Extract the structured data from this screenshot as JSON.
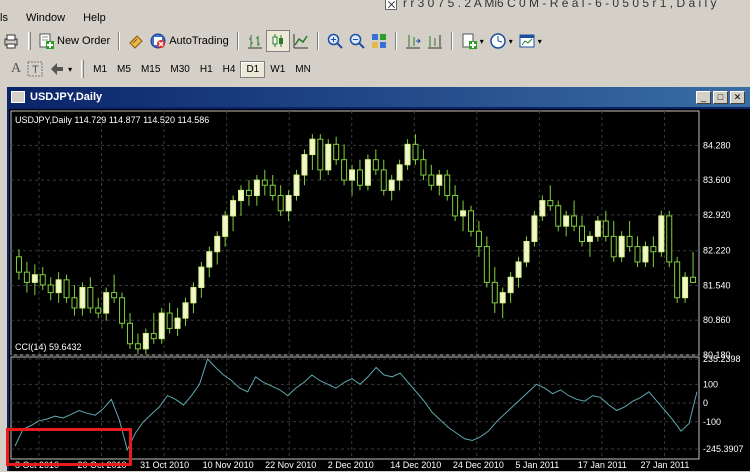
{
  "window_title_fragment": "r r 3 0 7 5 . 2 A Mi6 C 0 M - R e a l - 6 - 0 5 0 5 r 1 , D a i l y",
  "menu": [
    {
      "label": "ls"
    },
    {
      "label": "Window"
    },
    {
      "label": "Help"
    }
  ],
  "toolbar": {
    "new_order_label": "New Order",
    "auto_trading_label": "AutoTrading"
  },
  "timeframes": [
    "M1",
    "M5",
    "M15",
    "M30",
    "H1",
    "H4",
    "D1",
    "W1",
    "MN"
  ],
  "active_timeframe": "D1",
  "chart_window": {
    "title": "USDJPY,Daily",
    "header_text": "USDJPY,Daily  114.729 114.877 114.520 114.586",
    "indicator_text": "CCI(14) 59.6432"
  },
  "chart_data": {
    "type": "candlestick",
    "price_axis_ticks": [
      "84.280",
      "83.600",
      "82.920",
      "82.220",
      "81.540",
      "80.860",
      "80.180"
    ],
    "cci_axis_ticks": [
      "235.2398",
      "100",
      "0",
      "-100",
      "-245.3907"
    ],
    "x_tick_labels": [
      "8 Oct 2010",
      "20 Oct 2010",
      "31 Oct 2010",
      "10 Nov 2010",
      "22 Nov 2010",
      "2 Dec 2010",
      "14 Dec 2010",
      "24 Dec 2010",
      "5 Jan 2011",
      "17 Jan 2011",
      "27 Jan 2011"
    ],
    "price_range": [
      80.18,
      84.6
    ],
    "cci_range": [
      -245.3907,
      235.2398
    ],
    "candles": [
      [
        82.1,
        82.25,
        81.65,
        81.8
      ],
      [
        81.8,
        82.0,
        81.4,
        81.6
      ],
      [
        81.6,
        81.95,
        81.35,
        81.75
      ],
      [
        81.75,
        81.9,
        81.45,
        81.55
      ],
      [
        81.55,
        81.7,
        81.25,
        81.4
      ],
      [
        81.4,
        81.8,
        81.2,
        81.65
      ],
      [
        81.65,
        81.75,
        81.2,
        81.3
      ],
      [
        81.3,
        81.55,
        80.95,
        81.1
      ],
      [
        81.1,
        81.6,
        80.95,
        81.5
      ],
      [
        81.5,
        81.7,
        81.0,
        81.1
      ],
      [
        81.1,
        81.3,
        80.9,
        81.0
      ],
      [
        81.0,
        81.5,
        80.85,
        81.4
      ],
      [
        81.4,
        81.75,
        81.2,
        81.3
      ],
      [
        81.3,
        81.4,
        80.7,
        80.8
      ],
      [
        80.8,
        81.0,
        80.3,
        80.4
      ],
      [
        80.4,
        80.6,
        80.2,
        80.3
      ],
      [
        80.3,
        80.7,
        80.2,
        80.6
      ],
      [
        80.6,
        81.0,
        80.4,
        80.5
      ],
      [
        80.5,
        81.1,
        80.4,
        81.0
      ],
      [
        81.0,
        81.2,
        80.6,
        80.7
      ],
      [
        80.7,
        81.1,
        80.55,
        80.9
      ],
      [
        80.9,
        81.3,
        80.75,
        81.2
      ],
      [
        81.2,
        81.6,
        81.0,
        81.5
      ],
      [
        81.5,
        82.0,
        81.3,
        81.9
      ],
      [
        81.9,
        82.3,
        81.7,
        82.2
      ],
      [
        82.2,
        82.6,
        81.95,
        82.5
      ],
      [
        82.5,
        83.0,
        82.3,
        82.9
      ],
      [
        82.9,
        83.3,
        82.6,
        83.2
      ],
      [
        83.2,
        83.5,
        82.9,
        83.4
      ],
      [
        83.4,
        83.6,
        83.1,
        83.3
      ],
      [
        83.3,
        83.7,
        83.1,
        83.6
      ],
      [
        83.6,
        83.8,
        83.3,
        83.5
      ],
      [
        83.5,
        83.7,
        83.2,
        83.3
      ],
      [
        83.3,
        83.5,
        82.9,
        83.0
      ],
      [
        83.0,
        83.4,
        82.8,
        83.3
      ],
      [
        83.3,
        83.8,
        83.2,
        83.7
      ],
      [
        83.7,
        84.2,
        83.5,
        84.1
      ],
      [
        84.1,
        84.5,
        83.8,
        84.4
      ],
      [
        84.4,
        84.5,
        83.6,
        83.8
      ],
      [
        83.8,
        84.4,
        83.7,
        84.3
      ],
      [
        84.3,
        84.45,
        83.9,
        84.0
      ],
      [
        84.0,
        84.3,
        83.5,
        83.6
      ],
      [
        83.6,
        83.9,
        83.3,
        83.8
      ],
      [
        83.8,
        84.0,
        83.4,
        83.5
      ],
      [
        83.5,
        84.1,
        83.4,
        84.0
      ],
      [
        84.0,
        84.2,
        83.7,
        83.8
      ],
      [
        83.8,
        84.0,
        83.3,
        83.4
      ],
      [
        83.4,
        83.7,
        83.2,
        83.6
      ],
      [
        83.6,
        84.0,
        83.4,
        83.9
      ],
      [
        83.9,
        84.4,
        83.8,
        84.3
      ],
      [
        84.3,
        84.5,
        83.9,
        84.0
      ],
      [
        84.0,
        84.2,
        83.6,
        83.7
      ],
      [
        83.7,
        83.9,
        83.4,
        83.5
      ],
      [
        83.5,
        83.8,
        83.3,
        83.7
      ],
      [
        83.7,
        83.8,
        83.2,
        83.3
      ],
      [
        83.3,
        83.5,
        82.8,
        82.9
      ],
      [
        82.9,
        83.2,
        82.6,
        83.0
      ],
      [
        83.0,
        83.1,
        82.5,
        82.6
      ],
      [
        82.6,
        82.8,
        82.1,
        82.3
      ],
      [
        82.3,
        82.5,
        81.5,
        81.6
      ],
      [
        81.6,
        81.9,
        81.0,
        81.2
      ],
      [
        81.2,
        81.5,
        80.9,
        81.4
      ],
      [
        81.4,
        81.8,
        81.2,
        81.7
      ],
      [
        81.7,
        82.1,
        81.5,
        82.0
      ],
      [
        82.0,
        82.5,
        81.9,
        82.4
      ],
      [
        82.4,
        83.0,
        82.3,
        82.9
      ],
      [
        82.9,
        83.3,
        82.8,
        83.2
      ],
      [
        83.2,
        83.5,
        83.0,
        83.1
      ],
      [
        83.1,
        83.2,
        82.6,
        82.7
      ],
      [
        82.7,
        83.0,
        82.5,
        82.9
      ],
      [
        82.9,
        83.2,
        82.6,
        82.7
      ],
      [
        82.7,
        82.9,
        82.3,
        82.4
      ],
      [
        82.4,
        82.6,
        82.1,
        82.5
      ],
      [
        82.5,
        82.9,
        82.4,
        82.8
      ],
      [
        82.8,
        83.0,
        82.4,
        82.5
      ],
      [
        82.5,
        82.8,
        82.0,
        82.1
      ],
      [
        82.1,
        82.6,
        82.0,
        82.5
      ],
      [
        82.5,
        82.8,
        82.2,
        82.3
      ],
      [
        82.3,
        82.5,
        81.9,
        82.0
      ],
      [
        82.0,
        82.4,
        81.9,
        82.3
      ],
      [
        82.3,
        82.5,
        81.9,
        82.2
      ],
      [
        82.2,
        83.0,
        82.1,
        82.9
      ],
      [
        82.9,
        83.0,
        81.9,
        82.0
      ],
      [
        82.0,
        82.1,
        81.2,
        81.3
      ],
      [
        81.3,
        81.8,
        81.2,
        81.7
      ],
      [
        81.7,
        82.2,
        81.6,
        81.6
      ]
    ],
    "cci": [
      -230,
      -140,
      -120,
      -95,
      -85,
      -70,
      -80,
      -60,
      -40,
      -55,
      -65,
      -30,
      20,
      -90,
      -250,
      -160,
      -100,
      -60,
      -20,
      40,
      20,
      -10,
      40,
      100,
      235,
      190,
      150,
      120,
      80,
      60,
      140,
      110,
      90,
      70,
      40,
      80,
      110,
      150,
      120,
      100,
      80,
      110,
      130,
      100,
      140,
      190,
      150,
      140,
      160,
      110,
      60,
      10,
      -50,
      -90,
      -130,
      -160,
      -190,
      -200,
      -180,
      -150,
      -100,
      -60,
      -20,
      20,
      60,
      100,
      80,
      50,
      70,
      40,
      20,
      10,
      40,
      30,
      -10,
      -40,
      -20,
      10,
      30,
      60,
      10,
      -40,
      -90,
      -150,
      -110,
      60
    ]
  }
}
